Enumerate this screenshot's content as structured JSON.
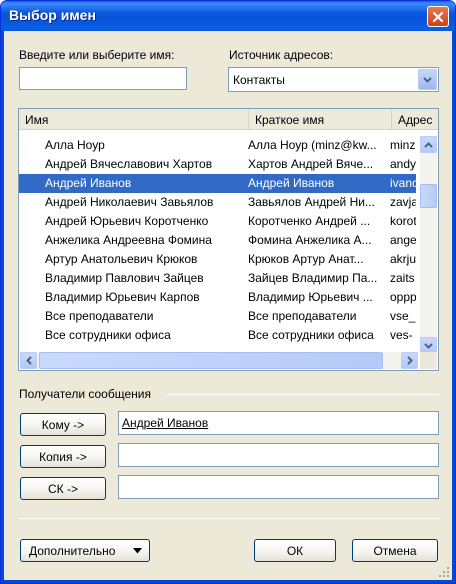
{
  "window": {
    "title": "Выбор имен"
  },
  "search": {
    "label": "Введите или выберите имя:",
    "label_hotkey_index": 4,
    "value": ""
  },
  "source": {
    "label": "Источник адресов:",
    "value": "Контакты"
  },
  "columns": [
    "Имя",
    "Краткое имя",
    "Адрес"
  ],
  "rows": [
    {
      "name": "Алла Ноур",
      "short": "Алла Ноур (minz@kw...",
      "addr": "minz",
      "selected": false
    },
    {
      "name": "Андрей Вячеславович Хартов",
      "short": "Хартов Андрей Вяче...",
      "addr": "andy",
      "selected": false
    },
    {
      "name": "Андрей Иванов",
      "short": "Андрей Иванов",
      "addr": "ivanс",
      "selected": true
    },
    {
      "name": "Андрей Николаевич Завьялов",
      "short": "Завьялов Андрей Ни...",
      "addr": "zavja",
      "selected": false
    },
    {
      "name": "Андрей Юрьевич Коротченко",
      "short": "Коротченко Андрей ...",
      "addr": "korot",
      "selected": false
    },
    {
      "name": "Анжелика Андреевна Фомина",
      "short": "Фомина Анжелика А...",
      "addr": "ange",
      "selected": false
    },
    {
      "name": "Артур Анатольевич Крюков",
      "short": "Крюков Артур Анат...",
      "addr": "akrju",
      "selected": false
    },
    {
      "name": "Владимир Павлович Зайцев",
      "short": "Зайцев Владимир Па...",
      "addr": "zaits",
      "selected": false
    },
    {
      "name": "Владимир Юрьевич Карпов",
      "short": "Владимир Юрьевич ...",
      "addr": "oppp",
      "selected": false
    },
    {
      "name": "Все преподаватели",
      "short": "Все преподаватели",
      "addr": "vse_",
      "selected": false
    },
    {
      "name": "Все сотрудники офиса",
      "short": "Все сотрудники офиса",
      "addr": "ves-",
      "selected": false
    }
  ],
  "recipients": {
    "group_label": "Получатели сообщения",
    "to": {
      "label": "Кому ->",
      "value": "Андрей Иванов"
    },
    "cc": {
      "label": "Копия ->",
      "value": ""
    },
    "bcc": {
      "label": "СК ->",
      "value": ""
    }
  },
  "buttons": {
    "more": "Дополнительно",
    "ok": "ОК",
    "cancel": "Отмена"
  },
  "colors": {
    "selection": "#316ac5",
    "title_bar": "#0a5ee8",
    "dialog_bg": "#ece9d8"
  }
}
